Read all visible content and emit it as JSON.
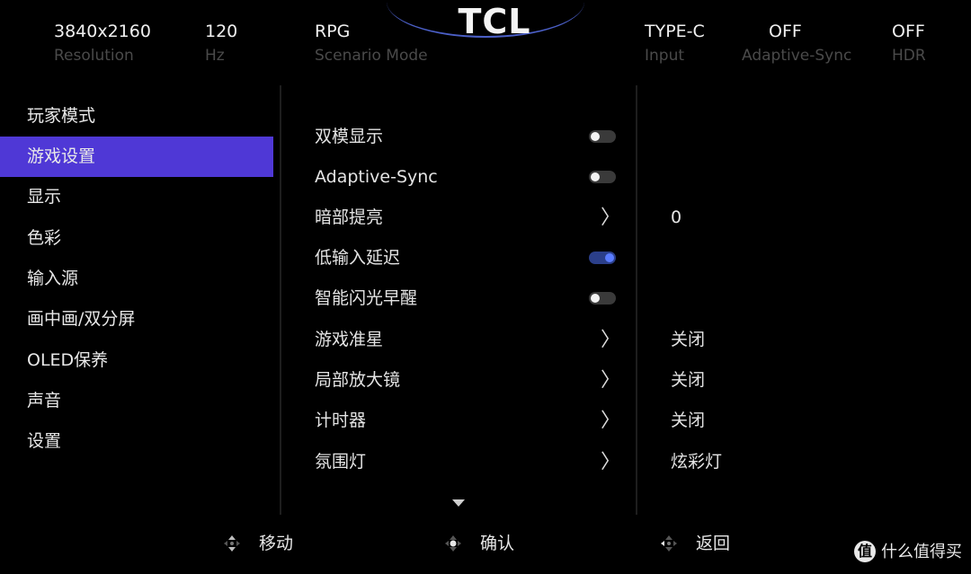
{
  "brand": "TCL",
  "status": [
    {
      "value": "3840x2160",
      "label": "Resolution"
    },
    {
      "value": "120",
      "label": "Hz"
    },
    {
      "value": "RPG",
      "label": "Scenario Mode"
    },
    {
      "value": "TYPE-C",
      "label": "Input"
    },
    {
      "value": "OFF",
      "label": "Adaptive-Sync"
    },
    {
      "value": "OFF",
      "label": "HDR"
    }
  ],
  "left_menu": [
    {
      "label": "玩家模式"
    },
    {
      "label": "游戏设置",
      "active": true
    },
    {
      "label": "显示"
    },
    {
      "label": "色彩"
    },
    {
      "label": "输入源"
    },
    {
      "label": "画中画/双分屏"
    },
    {
      "label": "OLED保养"
    },
    {
      "label": "声音"
    },
    {
      "label": "设置"
    }
  ],
  "settings": [
    {
      "label": "双模显示",
      "control": "toggle",
      "on": false
    },
    {
      "label": "Adaptive-Sync",
      "control": "toggle",
      "on": false
    },
    {
      "label": "暗部提亮",
      "control": "chevron",
      "value": "0"
    },
    {
      "label": "低输入延迟",
      "control": "toggle",
      "on": true
    },
    {
      "label": "智能闪光早醒",
      "control": "toggle",
      "on": false
    },
    {
      "label": "游戏准星",
      "control": "chevron",
      "value": "关闭"
    },
    {
      "label": "局部放大镜",
      "control": "chevron",
      "value": "关闭"
    },
    {
      "label": "计时器",
      "control": "chevron",
      "value": "关闭"
    },
    {
      "label": "氛围灯",
      "control": "chevron",
      "value": "炫彩灯"
    }
  ],
  "hints": [
    {
      "icon": "dpad-updown-icon",
      "label": "移动"
    },
    {
      "icon": "dpad-center-icon",
      "label": "确认"
    },
    {
      "icon": "dpad-left-icon",
      "label": "返回"
    }
  ],
  "watermark": {
    "glyph": "值",
    "text": "什么值得买"
  },
  "colors": {
    "accent": "#4f38d6",
    "toggle_on": "#5a7cff",
    "label_dim": "#4a4a4a"
  }
}
